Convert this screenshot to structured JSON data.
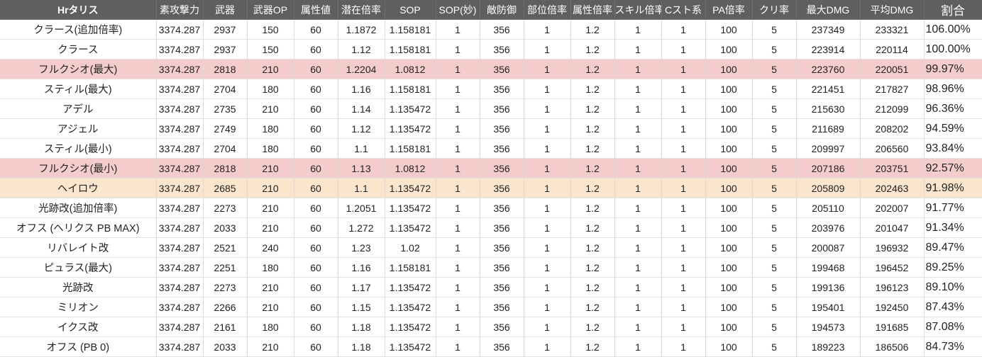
{
  "headers": [
    "Hrタリス",
    "素攻撃力",
    "武器",
    "武器OP",
    "属性値",
    "潜在倍率",
    "SOP",
    "SOP(妙)",
    "敵防御",
    "部位倍率",
    "属性倍率",
    "スキル倍率",
    "Cスト系",
    "PA倍率",
    "クリ率",
    "最大DMG",
    "平均DMG",
    "割合"
  ],
  "rows": [
    {
      "name": "クラース(追加倍率)",
      "vals": [
        "3374.287",
        "2937",
        "150",
        "60",
        "1.1872",
        "1.158181",
        "1",
        "356",
        "1",
        "1.2",
        "1",
        "1",
        "100",
        "5",
        "237349",
        "233321"
      ],
      "ratio": "106.00%",
      "hl": ""
    },
    {
      "name": "クラース",
      "vals": [
        "3374.287",
        "2937",
        "150",
        "60",
        "1.12",
        "1.158181",
        "1",
        "356",
        "1",
        "1.2",
        "1",
        "1",
        "100",
        "5",
        "223914",
        "220114"
      ],
      "ratio": "100.00%",
      "hl": ""
    },
    {
      "name": "フルクシオ(最大)",
      "vals": [
        "3374.287",
        "2818",
        "210",
        "60",
        "1.2204",
        "1.0812",
        "1",
        "356",
        "1",
        "1.2",
        "1",
        "1",
        "100",
        "5",
        "223760",
        "220051"
      ],
      "ratio": "99.97%",
      "hl": "red"
    },
    {
      "name": "スティル(最大)",
      "vals": [
        "3374.287",
        "2704",
        "180",
        "60",
        "1.16",
        "1.158181",
        "1",
        "356",
        "1",
        "1.2",
        "1",
        "1",
        "100",
        "5",
        "221451",
        "217827"
      ],
      "ratio": "98.96%",
      "hl": ""
    },
    {
      "name": "アデル",
      "vals": [
        "3374.287",
        "2735",
        "210",
        "60",
        "1.14",
        "1.135472",
        "1",
        "356",
        "1",
        "1.2",
        "1",
        "1",
        "100",
        "5",
        "215630",
        "212099"
      ],
      "ratio": "96.36%",
      "hl": ""
    },
    {
      "name": "アジェル",
      "vals": [
        "3374.287",
        "2749",
        "180",
        "60",
        "1.12",
        "1.135472",
        "1",
        "356",
        "1",
        "1.2",
        "1",
        "1",
        "100",
        "5",
        "211689",
        "208202"
      ],
      "ratio": "94.59%",
      "hl": ""
    },
    {
      "name": "スティル(最小)",
      "vals": [
        "3374.287",
        "2704",
        "180",
        "60",
        "1.1",
        "1.158181",
        "1",
        "356",
        "1",
        "1.2",
        "1",
        "1",
        "100",
        "5",
        "209997",
        "206560"
      ],
      "ratio": "93.84%",
      "hl": ""
    },
    {
      "name": "フルクシオ(最小)",
      "vals": [
        "3374.287",
        "2818",
        "210",
        "60",
        "1.13",
        "1.0812",
        "1",
        "356",
        "1",
        "1.2",
        "1",
        "1",
        "100",
        "5",
        "207186",
        "203751"
      ],
      "ratio": "92.57%",
      "hl": "red"
    },
    {
      "name": "ヘイロウ",
      "vals": [
        "3374.287",
        "2685",
        "210",
        "60",
        "1.1",
        "1.135472",
        "1",
        "356",
        "1",
        "1.2",
        "1",
        "1",
        "100",
        "5",
        "205809",
        "202463"
      ],
      "ratio": "91.98%",
      "hl": "orange"
    },
    {
      "name": "光跡改(追加倍率)",
      "vals": [
        "3374.287",
        "2273",
        "210",
        "60",
        "1.2051",
        "1.135472",
        "1",
        "356",
        "1",
        "1.2",
        "1",
        "1",
        "100",
        "5",
        "205110",
        "202007"
      ],
      "ratio": "91.77%",
      "hl": ""
    },
    {
      "name": "オフス (ヘリクス PB MAX)",
      "vals": [
        "3374.287",
        "2033",
        "210",
        "60",
        "1.272",
        "1.135472",
        "1",
        "356",
        "1",
        "1.2",
        "1",
        "1",
        "100",
        "5",
        "203976",
        "201047"
      ],
      "ratio": "91.34%",
      "hl": ""
    },
    {
      "name": "リバレイト改",
      "vals": [
        "3374.287",
        "2521",
        "240",
        "60",
        "1.23",
        "1.02",
        "1",
        "356",
        "1",
        "1.2",
        "1",
        "1",
        "100",
        "5",
        "200087",
        "196932"
      ],
      "ratio": "89.47%",
      "hl": ""
    },
    {
      "name": "ピュラス(最大)",
      "vals": [
        "3374.287",
        "2251",
        "180",
        "60",
        "1.16",
        "1.158181",
        "1",
        "356",
        "1",
        "1.2",
        "1",
        "1",
        "100",
        "5",
        "199468",
        "196452"
      ],
      "ratio": "89.25%",
      "hl": ""
    },
    {
      "name": "光跡改",
      "vals": [
        "3374.287",
        "2273",
        "210",
        "60",
        "1.17",
        "1.135472",
        "1",
        "356",
        "1",
        "1.2",
        "1",
        "1",
        "100",
        "5",
        "199136",
        "196123"
      ],
      "ratio": "89.10%",
      "hl": ""
    },
    {
      "name": "ミリオン",
      "vals": [
        "3374.287",
        "2266",
        "210",
        "60",
        "1.15",
        "1.135472",
        "1",
        "356",
        "1",
        "1.2",
        "1",
        "1",
        "100",
        "5",
        "195401",
        "192450"
      ],
      "ratio": "87.43%",
      "hl": ""
    },
    {
      "name": "イクス改",
      "vals": [
        "3374.287",
        "2161",
        "180",
        "60",
        "1.18",
        "1.135472",
        "1",
        "356",
        "1",
        "1.2",
        "1",
        "1",
        "100",
        "5",
        "194573",
        "191685"
      ],
      "ratio": "87.08%",
      "hl": ""
    },
    {
      "name": "オフス (PB 0)",
      "vals": [
        "3374.287",
        "2033",
        "210",
        "60",
        "1.18",
        "1.135472",
        "1",
        "356",
        "1",
        "1.2",
        "1",
        "1",
        "100",
        "5",
        "189223",
        "186506"
      ],
      "ratio": "84.73%",
      "hl": ""
    }
  ]
}
